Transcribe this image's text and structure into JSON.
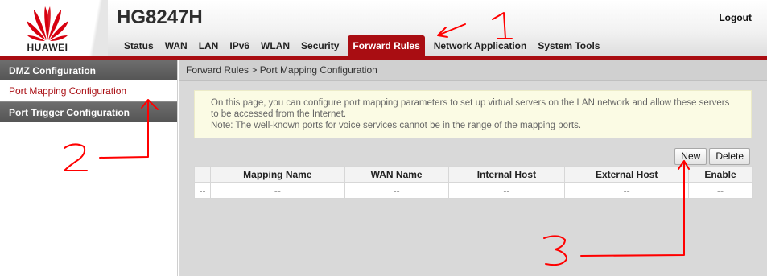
{
  "brand": {
    "logo_text": "HUAWEI",
    "logo_color": "#d7000f",
    "product": "HG8247H"
  },
  "header": {
    "logout": "Logout"
  },
  "nav": {
    "items": [
      "Status",
      "WAN",
      "LAN",
      "IPv6",
      "WLAN",
      "Security",
      "Forward Rules",
      "Network Application",
      "System Tools"
    ],
    "active": "Forward Rules"
  },
  "sidebar": {
    "items": [
      "DMZ Configuration",
      "Port Mapping Configuration",
      "Port Trigger Configuration"
    ],
    "active": "Port Mapping Configuration"
  },
  "breadcrumb": "Forward Rules > Port Mapping Configuration",
  "notice": {
    "line1": "On this page, you can configure port mapping parameters to set up virtual servers on the LAN network and allow these servers to be accessed from the Internet.",
    "line2": "Note: The well-known ports for voice services cannot be in the range of the mapping ports."
  },
  "toolbar": {
    "new": "New",
    "delete": "Delete"
  },
  "table": {
    "headers": [
      "",
      "Mapping Name",
      "WAN Name",
      "Internal Host",
      "External Host",
      "Enable"
    ],
    "rows": [
      [
        "--",
        "--",
        "--",
        "--",
        "--",
        "--"
      ]
    ]
  },
  "annotations": {
    "one": "1",
    "two": "2",
    "three": "3",
    "color": "#ff0000"
  },
  "colors": {
    "accent": "#a90d12",
    "notice_bg": "#fbfbe4",
    "content_bg": "#d9d9d9"
  }
}
